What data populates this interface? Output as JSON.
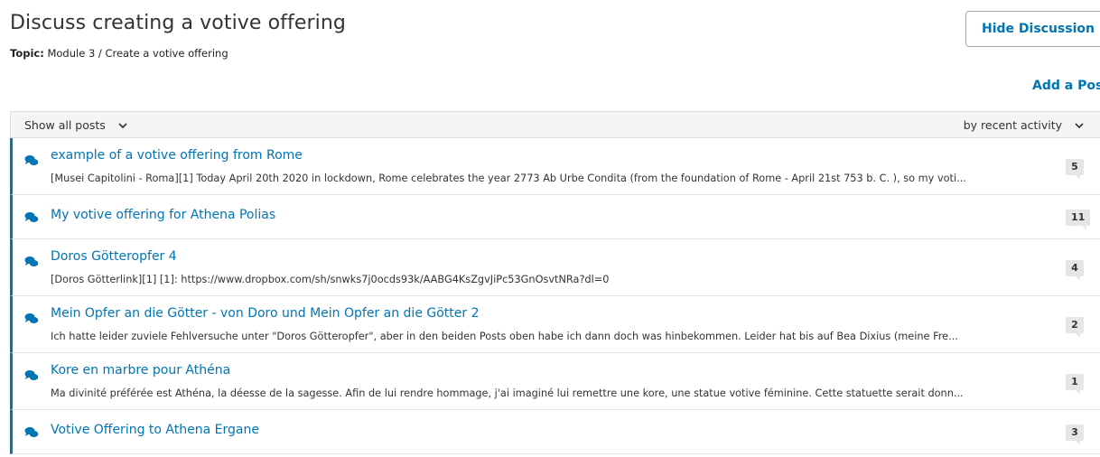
{
  "header": {
    "title": "Discuss creating a votive offering",
    "topic_label": "Topic:",
    "topic_value": "Module 3 / Create a votive offering",
    "hide_button": "Hide Discussion",
    "add_post": "Add a Post"
  },
  "filters": {
    "show_label": "Show all posts",
    "sort_label": "by recent activity"
  },
  "colors": {
    "accent": "#0075b4",
    "count_bg": "#e6e6e6",
    "filter_bg": "#f5f5f5"
  },
  "icons": {
    "post": "comments-icon",
    "dropdown": "chevron-down-icon"
  },
  "posts": [
    {
      "title": "example of a votive offering from Rome",
      "preview": "[Musei Capitolini - Roma][1] Today April 20th 2020 in lockdown, Rome celebrates the year 2773 Ab Urbe Condita (from the foundation of Rome - April 21st 753 b. C. ), so my voti...",
      "count": "5"
    },
    {
      "title": "My votive offering for Athena Polias",
      "preview": "",
      "count": "11"
    },
    {
      "title": "Doros Götteropfer 4",
      "preview": "[Doros Götterlink][1] [1]: https://www.dropbox.com/sh/snwks7j0ocds93k/AABG4KsZgvJiPc53GnOsvtNRa?dl=0",
      "count": "4"
    },
    {
      "title": "Mein Opfer an die Götter - von Doro und Mein Opfer an die Götter 2",
      "preview": "Ich hatte leider zuviele Fehlversuche unter \"Doros Götteropfer\", aber in den beiden Posts oben habe ich dann doch was hinbekommen. Leider hat bis auf Bea Dixius (meine Fre...",
      "count": "2"
    },
    {
      "title": "Kore en marbre pour Athéna",
      "preview": "Ma divinité préférée est Athéna, la déesse de la sagesse. Afin de lui rendre hommage, j'ai imaginé lui remettre une kore, une statue votive féminine. Cette statuette serait donn...",
      "count": "1"
    },
    {
      "title": "Votive Offering to Athena Ergane",
      "preview": "",
      "count": "3"
    }
  ]
}
